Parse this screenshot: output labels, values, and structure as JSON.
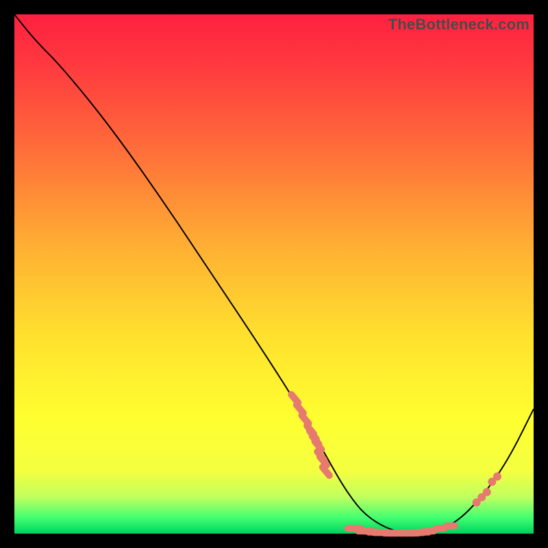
{
  "watermark": "TheBottleneck.com",
  "chart_data": {
    "type": "line",
    "title": "",
    "xlabel": "",
    "ylabel": "",
    "xlim": [
      0,
      100
    ],
    "ylim": [
      0,
      100
    ],
    "series": [
      {
        "name": "curve",
        "x": [
          0,
          4,
          9,
          18,
          28,
          38,
          48,
          55,
          60,
          64,
          68,
          74,
          80,
          85,
          90,
          95,
          100
        ],
        "y": [
          100,
          95,
          90,
          79,
          65,
          50,
          35,
          24,
          15,
          8,
          3,
          0,
          0,
          2,
          7,
          14,
          24
        ]
      }
    ],
    "markers": {
      "left_cluster": [
        [
          54,
          26
        ],
        [
          55,
          24
        ],
        [
          56,
          22
        ],
        [
          57,
          20
        ],
        [
          57.5,
          19
        ],
        [
          58,
          18
        ],
        [
          58.5,
          17
        ],
        [
          59,
          15
        ],
        [
          59.5,
          14
        ],
        [
          60,
          12
        ]
      ],
      "bottom_cluster": [
        [
          65,
          1
        ],
        [
          66,
          1
        ],
        [
          67,
          0.5
        ],
        [
          68,
          0.5
        ],
        [
          69,
          0.3
        ],
        [
          70,
          0.2
        ],
        [
          71,
          0.2
        ],
        [
          72,
          0.1
        ],
        [
          73,
          0.1
        ],
        [
          74,
          0.1
        ],
        [
          75,
          0.1
        ],
        [
          76,
          0.1
        ],
        [
          77,
          0.1
        ],
        [
          78,
          0.2
        ],
        [
          79,
          0.3
        ],
        [
          80,
          0.5
        ],
        [
          82,
          1
        ],
        [
          84,
          1.5
        ]
      ],
      "right_cluster": [
        [
          89,
          6
        ],
        [
          90,
          7
        ],
        [
          91,
          8
        ],
        [
          92,
          10
        ],
        [
          93,
          11
        ]
      ]
    }
  }
}
